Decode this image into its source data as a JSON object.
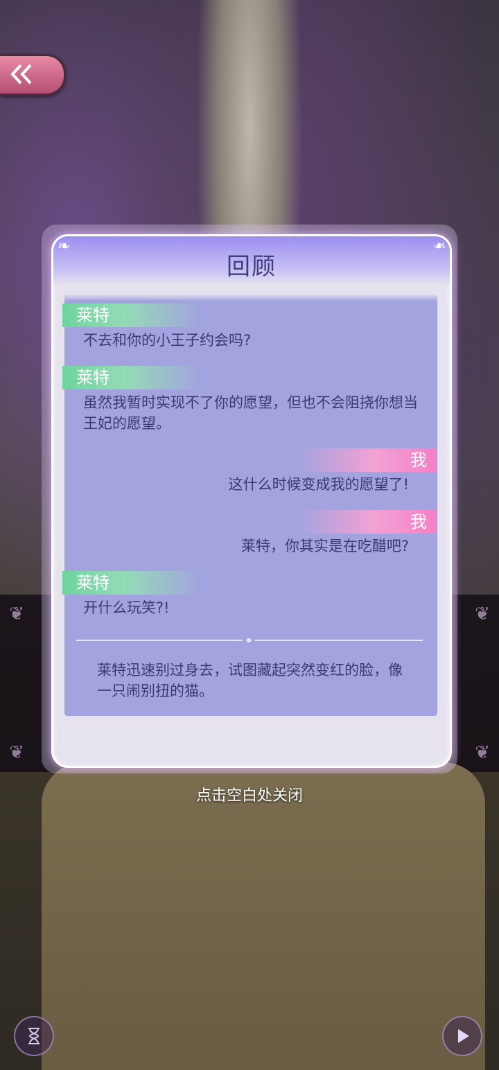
{
  "dialog": {
    "title": "回顾",
    "close_hint": "点击空白处关闭"
  },
  "log": [
    {
      "speaker": "莱特",
      "side": "left",
      "text": "不去和你的小王子约会吗?"
    },
    {
      "speaker": "莱特",
      "side": "left",
      "text": "虽然我暂时实现不了你的愿望，但也不会阻挠你想当王妃的愿望。"
    },
    {
      "speaker": "我",
      "side": "right",
      "text": "这什么时候变成我的愿望了!"
    },
    {
      "speaker": "我",
      "side": "right",
      "text": "莱特，你其实是在吃醋吧?"
    },
    {
      "speaker": "莱特",
      "side": "left",
      "text": "开什么玩笑?!"
    }
  ],
  "narration": "莱特迅速别过身去，试图藏起突然变红的脸，像一只闹别扭的猫。",
  "icons": {
    "back": "double-chevron-left-icon",
    "hourglass": "hourglass-icon",
    "play": "play-icon"
  },
  "colors": {
    "panel": "#a3a3e0",
    "title": "#3e3f7a",
    "npc_tag": "#6fd39f",
    "player_tag": "#f47fc6",
    "back_button": "#d4708f"
  }
}
